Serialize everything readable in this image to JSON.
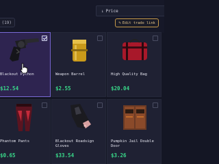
{
  "toolbar": {
    "sort_label": "Price",
    "selected_count": "(19)",
    "edit_trade_link_label": "Edit trade link"
  },
  "items": [
    {
      "name": "Blackout Python",
      "price": "$12.54",
      "selected": true
    },
    {
      "name": "Weapon Barrel",
      "price": "$2.55",
      "selected": false
    },
    {
      "name": "High Quality Bag",
      "price": "$20.04",
      "selected": false
    },
    {
      "name": "Phantom Pants",
      "price": "$0.65",
      "selected": false
    },
    {
      "name": "Blackout Roadsign Gloves",
      "price": "$33.54",
      "selected": false
    },
    {
      "name": "Pumpkin Jail Double Door",
      "price": "$3.26",
      "selected": false
    }
  ],
  "colors": {
    "background": "#141624",
    "card": "#1f2133",
    "card_selected": "#2e2450",
    "price": "#39d98a",
    "accent_gold": "#c79a4a"
  },
  "icons": [
    "sort-arrow-icon",
    "pencil-icon",
    "checkbox-icon",
    "hand-pointer-cursor-icon"
  ]
}
